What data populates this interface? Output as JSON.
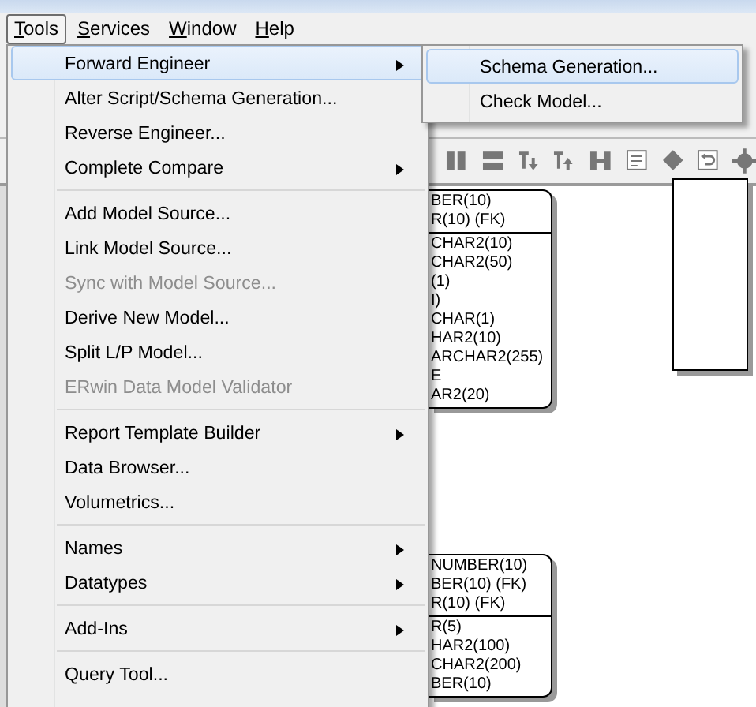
{
  "menubar": [
    {
      "label": "Tools",
      "selected": true
    },
    {
      "label": "Services",
      "selected": false
    },
    {
      "label": "Window",
      "selected": false
    },
    {
      "label": "Help",
      "selected": false
    }
  ],
  "tools_menu": {
    "items": [
      {
        "kind": "item",
        "label": "Forward Engineer",
        "submenu": true,
        "selected": true,
        "disabled": false
      },
      {
        "kind": "item",
        "label": "Alter Script/Schema Generation...",
        "submenu": false,
        "selected": false,
        "disabled": false
      },
      {
        "kind": "item",
        "label": "Reverse Engineer...",
        "submenu": false,
        "selected": false,
        "disabled": false
      },
      {
        "kind": "item",
        "label": "Complete Compare",
        "submenu": true,
        "selected": false,
        "disabled": false
      },
      {
        "kind": "separator"
      },
      {
        "kind": "item",
        "label": "Add Model Source...",
        "submenu": false,
        "selected": false,
        "disabled": false
      },
      {
        "kind": "item",
        "label": "Link Model Source...",
        "submenu": false,
        "selected": false,
        "disabled": false
      },
      {
        "kind": "item",
        "label": "Sync with Model Source...",
        "submenu": false,
        "selected": false,
        "disabled": true
      },
      {
        "kind": "item",
        "label": "Derive New Model...",
        "submenu": false,
        "selected": false,
        "disabled": false
      },
      {
        "kind": "item",
        "label": "Split L/P Model...",
        "submenu": false,
        "selected": false,
        "disabled": false
      },
      {
        "kind": "item",
        "label": "ERwin Data Model Validator",
        "submenu": false,
        "selected": false,
        "disabled": true
      },
      {
        "kind": "separator"
      },
      {
        "kind": "item",
        "label": "Report Template Builder",
        "submenu": true,
        "selected": false,
        "disabled": false
      },
      {
        "kind": "item",
        "label": "Data Browser...",
        "submenu": false,
        "selected": false,
        "disabled": false
      },
      {
        "kind": "item",
        "label": "Volumetrics...",
        "submenu": false,
        "selected": false,
        "disabled": false
      },
      {
        "kind": "separator"
      },
      {
        "kind": "item",
        "label": "Names",
        "submenu": true,
        "selected": false,
        "disabled": false
      },
      {
        "kind": "item",
        "label": "Datatypes",
        "submenu": true,
        "selected": false,
        "disabled": false
      },
      {
        "kind": "separator"
      },
      {
        "kind": "item",
        "label": "Add-Ins",
        "submenu": true,
        "selected": false,
        "disabled": false
      },
      {
        "kind": "separator"
      },
      {
        "kind": "item",
        "label": "Query Tool...",
        "submenu": false,
        "selected": false,
        "disabled": false
      }
    ]
  },
  "forward_engineer_submenu": {
    "items": [
      {
        "label": "Schema Generation...",
        "selected": true
      },
      {
        "label": "Check Model...",
        "selected": false
      }
    ]
  },
  "diagram": {
    "entities": [
      {
        "keys": [
          "BER(10)",
          "R(10) (FK)"
        ],
        "attributes": [
          "CHAR2(10)",
          "CHAR2(50)",
          "(1)",
          "I)",
          "CHAR(1)",
          "HAR2(10)",
          "ARCHAR2(255)",
          "E",
          "AR2(20)"
        ]
      },
      {
        "keys": [
          "NUMBER(10)",
          "BER(10) (FK)",
          "R(10) (FK)"
        ],
        "attributes": [
          "R(5)",
          "HAR2(100)",
          "CHAR2(200)",
          "BER(10)"
        ]
      }
    ]
  }
}
